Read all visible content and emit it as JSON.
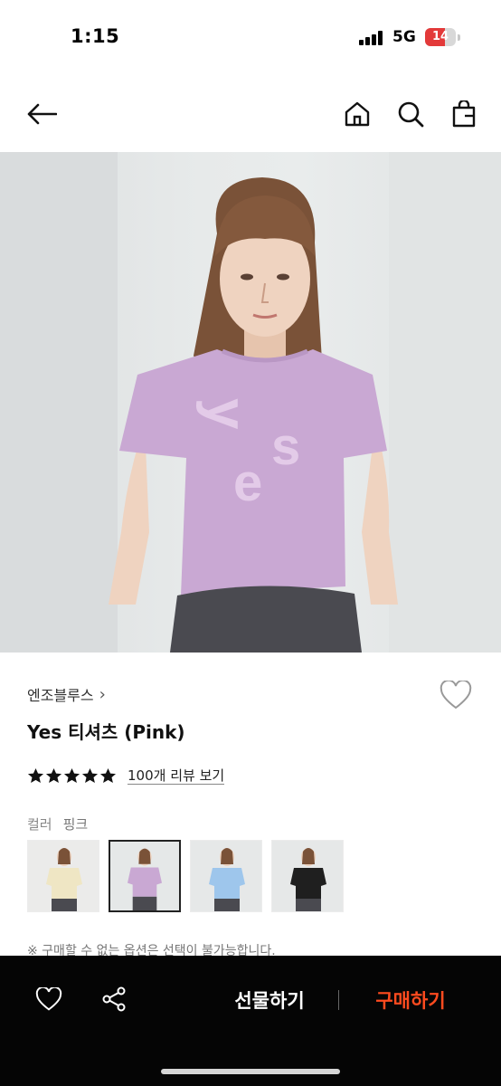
{
  "status_bar": {
    "time": "1:15",
    "network": "5G",
    "battery": "14"
  },
  "header": {
    "icons": [
      "back-arrow-icon",
      "home-icon",
      "search-icon",
      "shopping-bag-icon"
    ]
  },
  "product": {
    "brand": "엔조블루스",
    "brand_chevron": "›",
    "title": "Yes 티셔츠 (Pink)",
    "rating": 5,
    "review_link": "100개 리뷰 보기",
    "color_label": "컬러",
    "color_value": "핑크",
    "shirt_print": "Yes",
    "swatches": [
      {
        "name": "cream",
        "shirt_color": "#efe6c4",
        "selected": false
      },
      {
        "name": "pink",
        "shirt_color": "#c9a8d3",
        "selected": true
      },
      {
        "name": "blue",
        "shirt_color": "#9ec6ec",
        "selected": false
      },
      {
        "name": "black",
        "shirt_color": "#1f1f1f",
        "selected": false
      }
    ],
    "notice": "※ 구매할 수 없는 옵션은 선택이 불가능합니다."
  },
  "colors": {
    "accent": "#ff4b1f",
    "bottom_bar": "#050505",
    "shirt": "#c9a8d3"
  },
  "bottom_bar": {
    "gift_label": "선물하기",
    "buy_label": "구매하기"
  }
}
